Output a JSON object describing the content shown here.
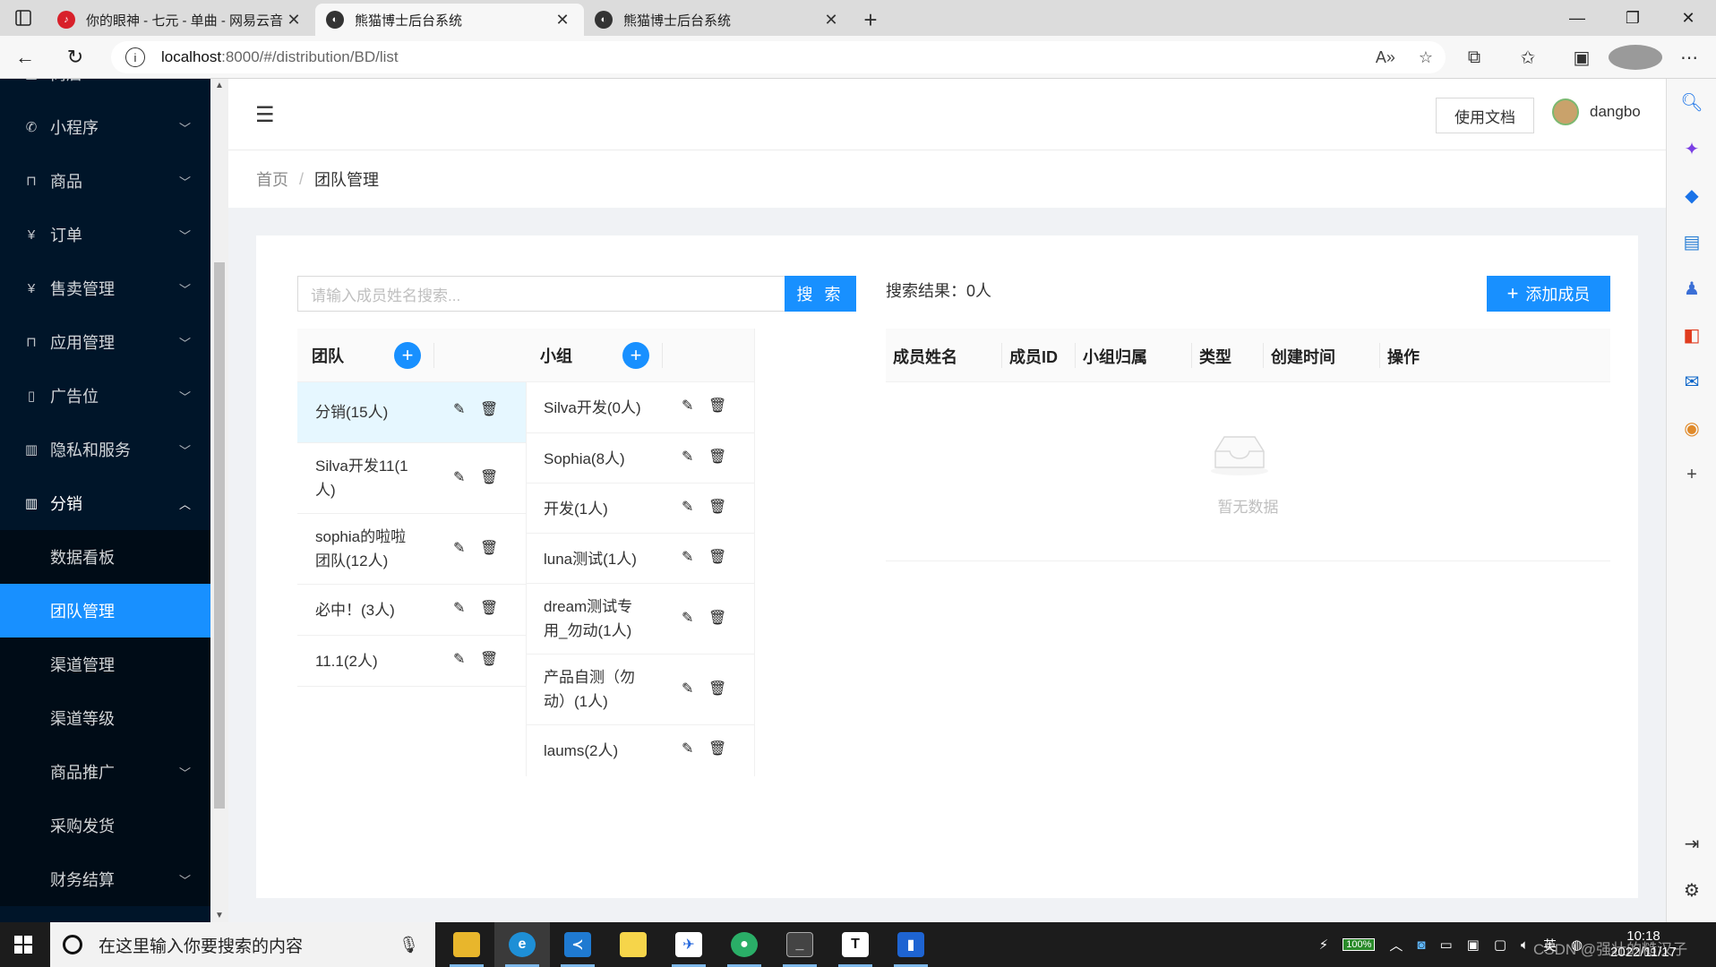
{
  "browser": {
    "tabs": [
      {
        "title": "你的眼神 - 七元 - 单曲 - 网易云音乐",
        "active": false
      },
      {
        "title": "熊猫博士后台系统",
        "active": true
      },
      {
        "title": "熊猫博士后台系统",
        "active": false
      }
    ],
    "url_host": "localhost",
    "url_path": ":8000/#/distribution/BD/list"
  },
  "sidebar": {
    "items": [
      {
        "label": "商店",
        "icon": "shop-icon"
      },
      {
        "label": "小程序",
        "icon": "wechat-icon"
      },
      {
        "label": "商品",
        "icon": "bag-icon"
      },
      {
        "label": "订单",
        "icon": "yen-icon"
      },
      {
        "label": "售卖管理",
        "icon": "yen-icon"
      },
      {
        "label": "应用管理",
        "icon": "bag-icon"
      },
      {
        "label": "广告位",
        "icon": "file-icon"
      },
      {
        "label": "隐私和服务",
        "icon": "book-icon"
      },
      {
        "label": "分销",
        "icon": "book-icon"
      }
    ],
    "sub_items": [
      {
        "label": "数据看板"
      },
      {
        "label": "团队管理"
      },
      {
        "label": "渠道管理"
      },
      {
        "label": "渠道等级"
      },
      {
        "label": "商品推广"
      },
      {
        "label": "采购发货"
      },
      {
        "label": "财务结算"
      }
    ]
  },
  "header": {
    "doc_button": "使用文档",
    "username": "dangbo"
  },
  "breadcrumb": {
    "home": "首页",
    "separator": "/",
    "current": "团队管理"
  },
  "search": {
    "placeholder": "请输入成员姓名搜索...",
    "button": "搜 索"
  },
  "teams": {
    "header": "团队",
    "rows": [
      "分销(15人)",
      "Silva开发11(1人)",
      "sophia的啦啦团队(12人)",
      "必中！(3人)",
      "11.1(2人)"
    ]
  },
  "groups": {
    "header": "小组",
    "rows": [
      "Silva开发(0人)",
      "Sophia(8人)",
      "开发(1人)",
      "luna测试(1人)",
      "dream测试专用_勿动(1人)",
      "产品自测（勿动）(1人)",
      "laums(2人)"
    ]
  },
  "results": {
    "label": "搜索结果：0人",
    "add_button": "添加成员",
    "columns": [
      "成员姓名",
      "成员ID",
      "小组归属",
      "类型",
      "创建时间",
      "操作"
    ],
    "empty_text": "暂无数据"
  },
  "taskbar": {
    "search_placeholder": "在这里输入你要搜索的内容",
    "battery": "100%",
    "ime": "英",
    "time": "10:18",
    "date": "2022/11/17",
    "watermark": "CSDN @强壮的糙汉子"
  },
  "colors": {
    "primary": "#1890ff",
    "sidebar_bg": "#001529",
    "submenu_bg": "#000c17"
  }
}
